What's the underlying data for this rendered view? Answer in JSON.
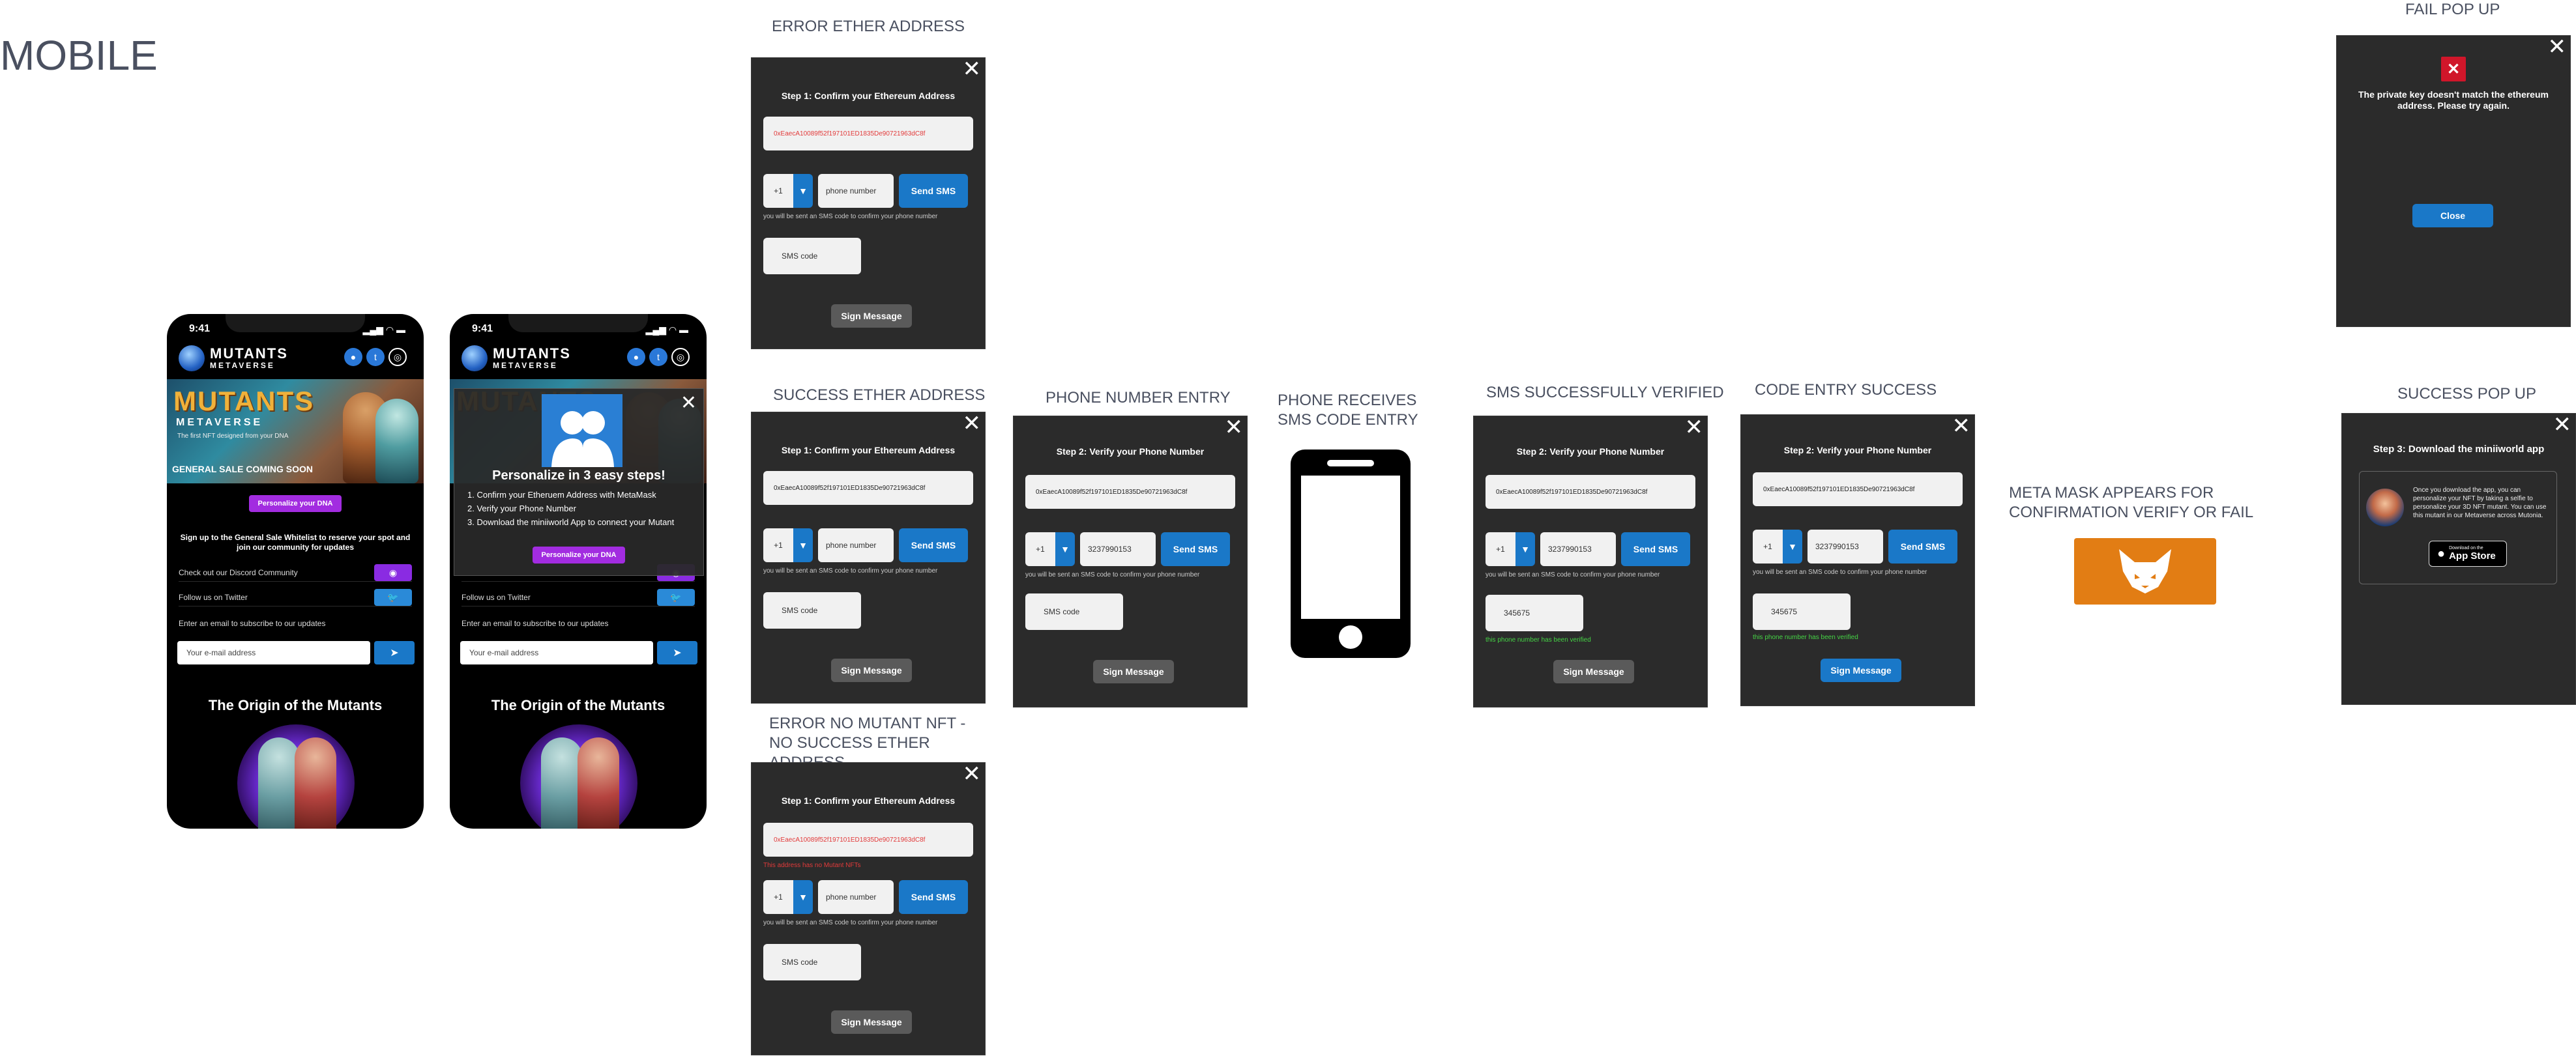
{
  "page": {
    "title": "MOBILE"
  },
  "labels": {
    "error_ether": "ERROR ETHER ADDRESS",
    "success_ether": "SUCCESS ETHER ADDRESS",
    "error_no_mutant": "ERROR NO MUTANT NFT - NO SUCCESS ETHER ADDRESS",
    "phone_number_entry": "PHONE NUMBER ENTRY",
    "phone_receives": "PHONE RECEIVES SMS CODE ENTRY",
    "sms_verified": "SMS SUCCESSFULLY VERIFIED",
    "code_entry_success": "CODE ENTRY SUCCESS",
    "metamask": "META MASK APPEARS FOR CONFIRMATION VERIFY OR FAIL",
    "fail_popup": "FAIL POP UP",
    "success_popup": "SUCCESS POP UP"
  },
  "phone": {
    "time": "9:41",
    "brand_top": "MUTANTS",
    "brand_bottom": "METAVERSE",
    "hero_title": "MUTANTS",
    "hero_sub": "METAVERSE",
    "hero_tag": "The first NFT designed from your DNA",
    "coming_soon": "GENERAL SALE COMING SOON",
    "personalize_btn": "Personalize your DNA",
    "signup_text": "Sign up to the General Sale Whitelist to reserve your spot and join our community for updates",
    "discord_row": "Check out our Discord Community",
    "twitter_row": "Follow us on Twitter",
    "email_row": "Enter an email to subscribe to our updates",
    "email_placeholder": "Your e-mail address",
    "origin": "The Origin of the Mutants"
  },
  "overlay": {
    "title": "Personalize in 3 easy steps!",
    "step1": "1. Confirm your Etheruem Address with MetaMask",
    "step2": "2. Verify your Phone Number",
    "step3": "3. Download the miniiworld App to connect your Mutant",
    "btn": "Personalize your DNA"
  },
  "dialog": {
    "step1_title": "Step 1: Confirm your Ethereum Address",
    "step2_title": "Step 2: Verify your Phone Number",
    "step3_title": "Step 3: Download the miniiworld app",
    "address": "0xEaecA10089f52f197101ED1835De90721963dC8f",
    "no_mutant_error": "This address has no Mutant NFTs",
    "country_code": "+1",
    "phone_placeholder": "phone number",
    "phone_value": "3237990153",
    "send_sms": "Send SMS",
    "sms_hint": "you will be sent an SMS code to confirm your phone number",
    "sms_placeholder": "SMS code",
    "sms_value": "345675",
    "verified": "this phone number has been verified",
    "sign": "Sign Message"
  },
  "fail": {
    "message": "The private key doesn't match the ethereum address. Please try again.",
    "close": "Close"
  },
  "success": {
    "desc": "Once you download the app, you can personalize your NFT by taking a selfie to personalize your 3D NFT mutant. You can use this mutant in our Metaverse across Mutonia.",
    "store_small": "Download on the",
    "store_big": "App Store"
  }
}
